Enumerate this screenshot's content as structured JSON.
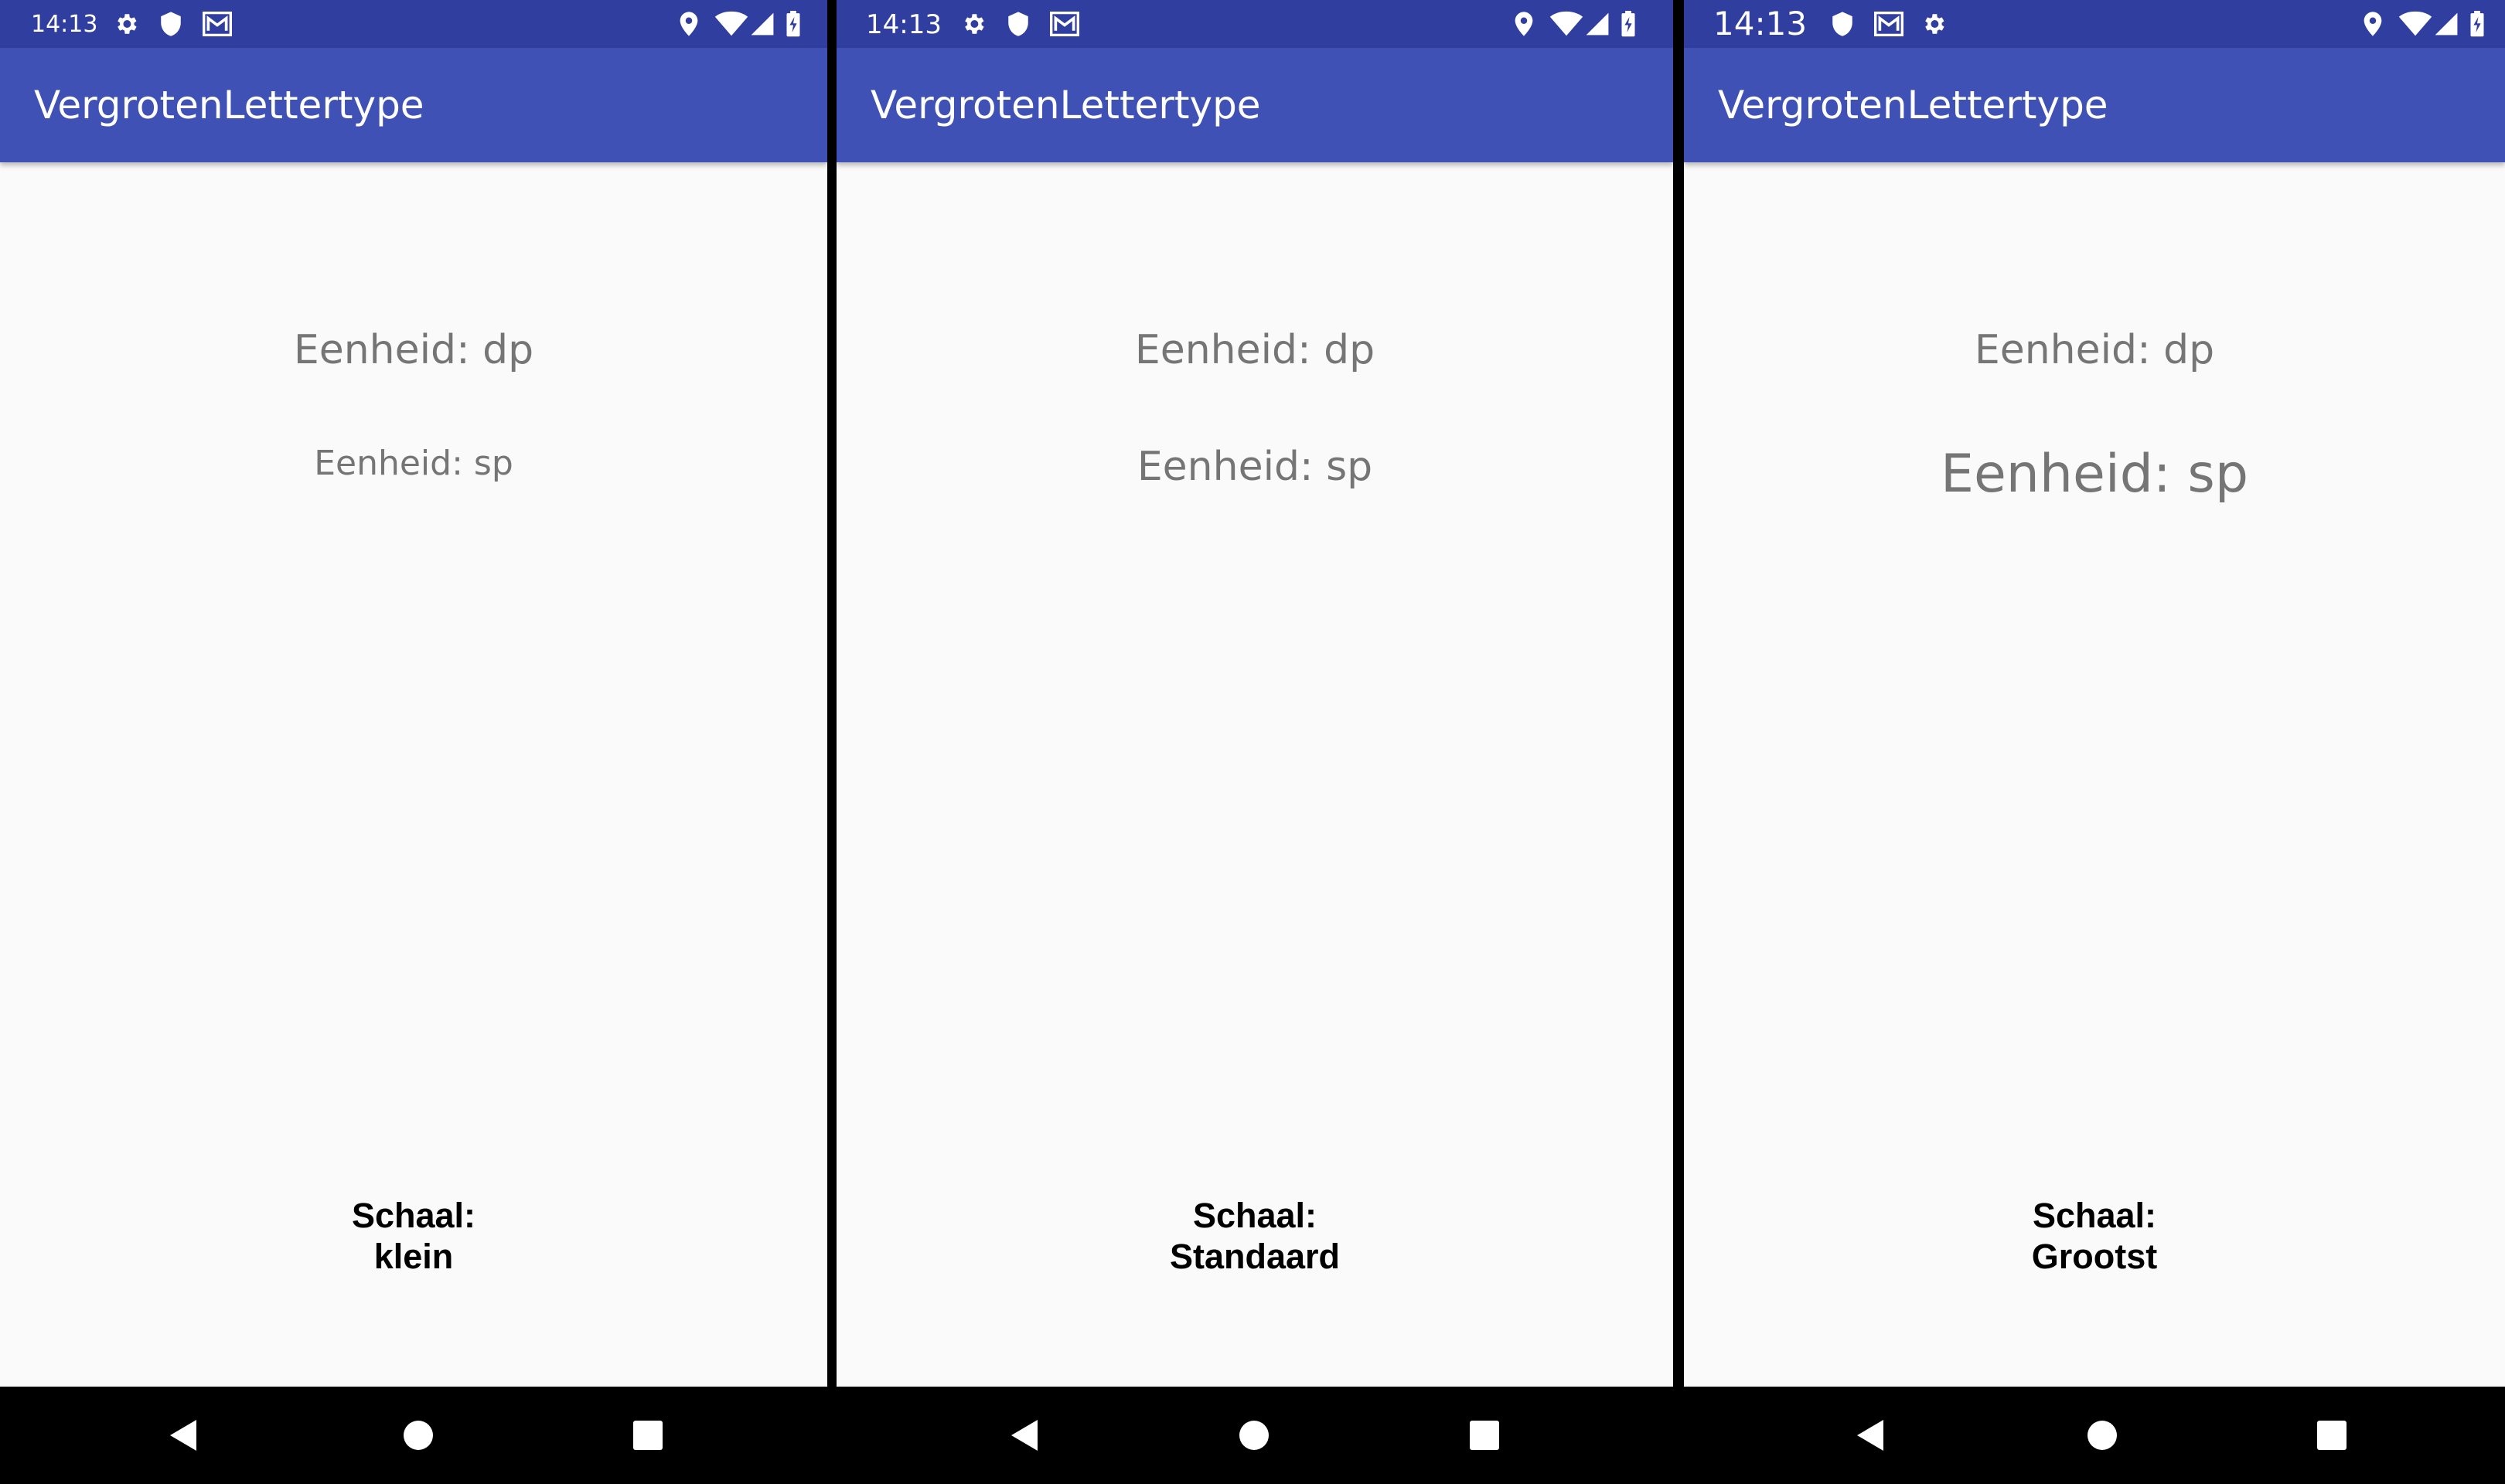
{
  "screens": [
    {
      "status": {
        "time": "14:13"
      },
      "app_title": "VergrotenLettertype",
      "dp_label": "Eenheid: dp",
      "sp_label": "Eenheid: sp",
      "scale_heading": "Schaal:",
      "scale_value": "klein"
    },
    {
      "status": {
        "time": "14:13"
      },
      "app_title": "VergrotenLettertype",
      "dp_label": "Eenheid: dp",
      "sp_label": "Eenheid: sp",
      "scale_heading": "Schaal:",
      "scale_value": "Standaard"
    },
    {
      "status": {
        "time": "14:13"
      },
      "app_title": "VergrotenLettertype",
      "dp_label": "Eenheid: dp",
      "sp_label": "Eenheid: sp",
      "scale_heading": "Schaal:",
      "scale_value": "Grootst"
    }
  ],
  "status_icons_left": [
    [
      "settings-icon",
      "shield-icon",
      "gmail-icon"
    ],
    [
      "settings-icon",
      "shield-icon",
      "gmail-icon"
    ],
    [
      "shield-icon",
      "gmail-icon",
      "settings-icon"
    ]
  ],
  "status_icons_right": [
    "location-icon",
    "wifi-icon",
    "signal-icon",
    "battery-charging-icon"
  ],
  "nav_buttons": [
    "back-icon",
    "home-icon",
    "recents-icon"
  ],
  "colors": {
    "status_bar": "#303f9f",
    "app_bar": "#3f51b5",
    "background": "#fafafa",
    "label_text": "#757575",
    "nav_bar": "#000000"
  }
}
